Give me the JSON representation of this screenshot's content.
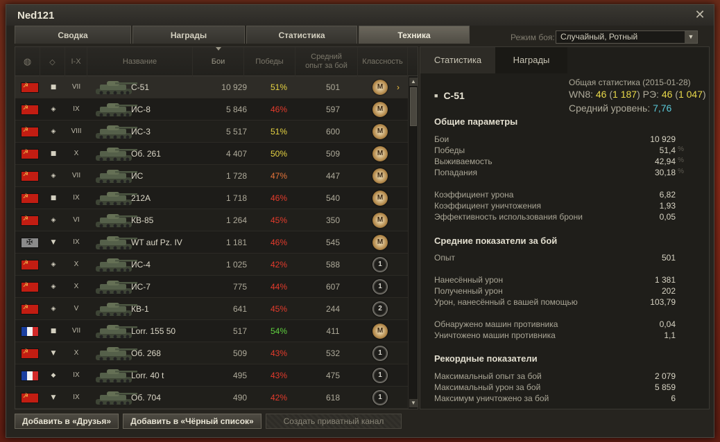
{
  "window": {
    "title": "Ned121"
  },
  "tabs": [
    "Сводка",
    "Награды",
    "Статистика",
    "Техника"
  ],
  "battle_mode": {
    "label": "Режим боя:",
    "value": "Случайный, Ротный"
  },
  "list": {
    "headers": {
      "tier": "I-X",
      "name": "Название",
      "battles": "Бои",
      "wins": "Победы",
      "avg_xp_line1": "Средний",
      "avg_xp_line2": "опыт за бой",
      "mastery": "Классность"
    },
    "rows": [
      {
        "nation": "ussr",
        "class": "medium",
        "tier": "VII",
        "name": "С-51",
        "battles": "10 929",
        "winrate": "51%",
        "wincolor": "#e6d342",
        "avgxp": "501",
        "mastery": "M",
        "badge": "gold"
      },
      {
        "nation": "ussr",
        "class": "heavy",
        "tier": "IX",
        "name": "ИС-8",
        "battles": "5 846",
        "winrate": "46%",
        "wincolor": "#e43b2c",
        "avgxp": "597",
        "mastery": "M",
        "badge": "gold"
      },
      {
        "nation": "ussr",
        "class": "heavy",
        "tier": "VIII",
        "name": "ИС-3",
        "battles": "5 517",
        "winrate": "51%",
        "wincolor": "#e6d342",
        "avgxp": "600",
        "mastery": "M",
        "badge": "gold"
      },
      {
        "nation": "ussr",
        "class": "medium",
        "tier": "X",
        "name": "Об. 261",
        "battles": "4 407",
        "winrate": "50%",
        "wincolor": "#e6d342",
        "avgxp": "509",
        "mastery": "M",
        "badge": "gold"
      },
      {
        "nation": "ussr",
        "class": "heavy",
        "tier": "VII",
        "name": "ИС",
        "battles": "1 728",
        "winrate": "47%",
        "wincolor": "#e6743a",
        "avgxp": "447",
        "mastery": "M",
        "badge": "gold"
      },
      {
        "nation": "ussr",
        "class": "medium",
        "tier": "IX",
        "name": "212А",
        "battles": "1 718",
        "winrate": "46%",
        "wincolor": "#e43b2c",
        "avgxp": "540",
        "mastery": "M",
        "badge": "gold"
      },
      {
        "nation": "ussr",
        "class": "heavy",
        "tier": "VI",
        "name": "КВ-85",
        "battles": "1 264",
        "winrate": "45%",
        "wincolor": "#e43b2c",
        "avgxp": "350",
        "mastery": "M",
        "badge": "gold"
      },
      {
        "nation": "germany",
        "class": "td",
        "tier": "IX",
        "name": "WT auf Pz. IV",
        "battles": "1 181",
        "winrate": "46%",
        "wincolor": "#e43b2c",
        "avgxp": "545",
        "mastery": "M",
        "badge": "gold"
      },
      {
        "nation": "ussr",
        "class": "heavy",
        "tier": "X",
        "name": "ИС-4",
        "battles": "1 025",
        "winrate": "42%",
        "wincolor": "#e43b2c",
        "avgxp": "588",
        "mastery": "1",
        "badge": "silver"
      },
      {
        "nation": "ussr",
        "class": "heavy",
        "tier": "X",
        "name": "ИС-7",
        "battles": "775",
        "winrate": "44%",
        "wincolor": "#e43b2c",
        "avgxp": "607",
        "mastery": "1",
        "badge": "silver"
      },
      {
        "nation": "ussr",
        "class": "heavy",
        "tier": "V",
        "name": "КВ-1",
        "battles": "641",
        "winrate": "45%",
        "wincolor": "#e43b2c",
        "avgxp": "244",
        "mastery": "2",
        "badge": "silver"
      },
      {
        "nation": "france",
        "class": "medium",
        "tier": "VII",
        "name": "Lorr. 155 50",
        "battles": "517",
        "winrate": "54%",
        "wincolor": "#5fd13f",
        "avgxp": "411",
        "mastery": "M",
        "badge": "gold"
      },
      {
        "nation": "ussr",
        "class": "td",
        "tier": "X",
        "name": "Об. 268",
        "battles": "509",
        "winrate": "43%",
        "wincolor": "#e43b2c",
        "avgxp": "532",
        "mastery": "1",
        "badge": "silver"
      },
      {
        "nation": "france",
        "class": "light",
        "tier": "IX",
        "name": "Lorr. 40 t",
        "battles": "495",
        "winrate": "43%",
        "wincolor": "#e43b2c",
        "avgxp": "475",
        "mastery": "1",
        "badge": "silver"
      },
      {
        "nation": "ussr",
        "class": "td",
        "tier": "IX",
        "name": "Об. 704",
        "battles": "490",
        "winrate": "42%",
        "wincolor": "#e43b2c",
        "avgxp": "618",
        "mastery": "1",
        "badge": "silver"
      }
    ]
  },
  "stats": {
    "tabs": [
      "Статистика",
      "Награды"
    ],
    "overall": "Общая статистика (2015-01-28)",
    "wn8_label": "WN8:",
    "wn8_value": "46",
    "wn8_paren": "1 187",
    "re_label": "РЭ:",
    "re_value": "46",
    "re_paren": "1 047",
    "avg_level_label": "Средний уровень:",
    "avg_level_value": "7,76",
    "vehicle": "С-51",
    "sections": {
      "general": "Общие параметры",
      "per_battle": "Средние показатели за бой",
      "records": "Рекордные показатели"
    },
    "general": [
      {
        "label": "Бои",
        "value": "10 929",
        "pct": ""
      },
      {
        "label": "Победы",
        "value": "51,4",
        "pct": "%"
      },
      {
        "label": "Выживаемость",
        "value": "42,94",
        "pct": "%"
      },
      {
        "label": "Попадания",
        "value": "30,18",
        "pct": "%"
      }
    ],
    "ratios": [
      {
        "label": "Коэффициент урона",
        "value": "6,82"
      },
      {
        "label": "Коэффициент уничтожения",
        "value": "1,93"
      },
      {
        "label": "Эффективность использования брони",
        "value": "0,05"
      }
    ],
    "per_battle_xp": [
      {
        "label": "Опыт",
        "value": "501"
      }
    ],
    "per_battle_dmg": [
      {
        "label": "Нанесённый урон",
        "value": "1 381"
      },
      {
        "label": "Полученный урон",
        "value": "202"
      },
      {
        "label": "Урон, нанесённый с вашей помощью",
        "value": "103,79"
      }
    ],
    "per_battle_spot": [
      {
        "label": "Обнаружено машин противника",
        "value": "0,04"
      },
      {
        "label": "Уничтожено машин противника",
        "value": "1,1"
      }
    ],
    "records": [
      {
        "label": "Максимальный опыт за бой",
        "value": "2 079"
      },
      {
        "label": "Максимальный урон за бой",
        "value": "5 859"
      },
      {
        "label": "Максимум уничтожено за бой",
        "value": "6"
      }
    ]
  },
  "buttons": {
    "add_friend": "Добавить в «Друзья»",
    "add_blacklist": "Добавить в «Чёрный список»",
    "private_channel": "Создать приватный канал"
  }
}
